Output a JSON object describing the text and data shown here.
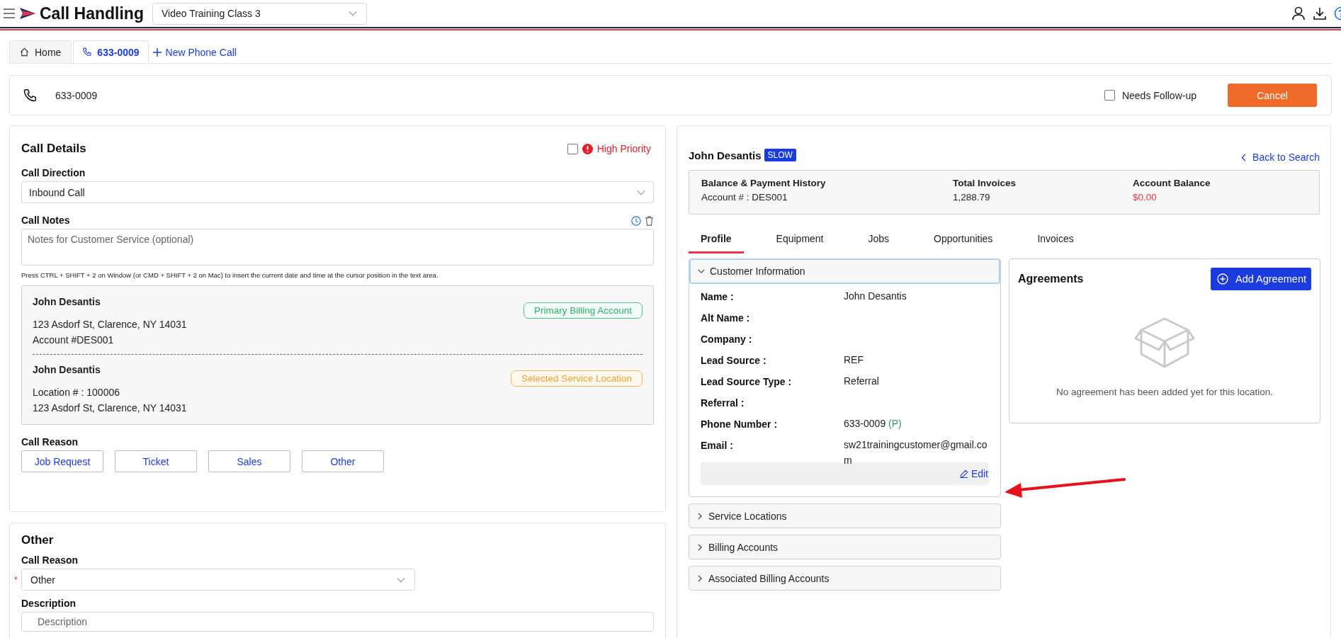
{
  "app": {
    "title": "Call Handling",
    "class_select": "Video Training Class 3"
  },
  "tabs": [
    {
      "kind": "home",
      "label": "Home",
      "selected": false
    },
    {
      "kind": "phone",
      "label": "633-0009",
      "selected": true
    }
  ],
  "new_tab_link": "New Phone Call",
  "call_bar": {
    "phone": "633-0009",
    "follow_up": {
      "label": "Needs Follow-up",
      "checked": false
    },
    "cancel": "Cancel"
  },
  "call_details": {
    "title": "Call Details",
    "high_priority": {
      "label": "High Priority",
      "checked": false
    },
    "direction": {
      "label": "Call Direction",
      "value": "Inbound Call"
    },
    "notes": {
      "label": "Call Notes",
      "placeholder": "Notes for Customer Service (optional)",
      "hint": "Press CTRL + SHIFT + 2 on Window (or CMD + SHIFT + 2 on Mac) to insert the current date and time at the cursor position in the text area."
    },
    "accounts": [
      {
        "kind": "billing",
        "name": "John Desantis",
        "lines": [
          "123 Asdorf St, Clarence, NY 14031",
          "Account #DES001"
        ],
        "tag": "Primary Billing Account"
      },
      {
        "kind": "location",
        "name": "John Desantis",
        "lines": [
          "Location # : 100006",
          "123 Asdorf St, Clarence, NY 14031"
        ],
        "tag": "Selected Service Location"
      }
    ],
    "reason": {
      "label": "Call Reason",
      "buttons": [
        "Job Request",
        "Ticket",
        "Sales",
        "Other"
      ]
    }
  },
  "other": {
    "title": "Other",
    "reason": {
      "label": "Call Reason",
      "value": "Other",
      "required_mark": "*"
    },
    "description": {
      "label": "Description",
      "placeholder": "Description"
    }
  },
  "customer": {
    "name": "John Desantis",
    "badge": "SLOW",
    "back": "Back to Search",
    "summary": [
      {
        "kind": "plain",
        "label": "Balance & Payment History",
        "value": "Account # : DES001"
      },
      {
        "kind": "plain",
        "label": "Total Invoices",
        "value": "1,288.79"
      },
      {
        "kind": "balance",
        "label": "Account Balance",
        "value": "$0.00"
      }
    ],
    "profile_tabs": [
      {
        "label": "Profile",
        "selected": true
      },
      {
        "label": "Equipment",
        "selected": false
      },
      {
        "label": "Jobs",
        "selected": false
      },
      {
        "label": "Opportunities",
        "selected": false
      },
      {
        "label": "Invoices",
        "selected": false
      }
    ],
    "customer_info": {
      "title": "Customer Information",
      "expanded": true,
      "fields": [
        {
          "label": "Name :",
          "value": "John Desantis"
        },
        {
          "label": "Alt Name :"
        },
        {
          "label": "Company :"
        },
        {
          "label": "Lead Source :",
          "value": "REF"
        },
        {
          "label": "Lead Source Type :",
          "value": "Referral"
        },
        {
          "label": "Referral :"
        },
        {
          "label": "Phone Number :",
          "value": "633-0009",
          "tag": "(P)"
        },
        {
          "label": "Email :",
          "value": "sw21trainingcustomer@gmail.com"
        }
      ],
      "edit": "Edit"
    },
    "sections": [
      {
        "title": "Service Locations",
        "expanded": false
      },
      {
        "title": "Billing Accounts",
        "expanded": false
      },
      {
        "title": "Associated Billing Accounts",
        "expanded": false
      }
    ],
    "agreements": {
      "title": "Agreements",
      "button": "Add Agreement",
      "empty": "No agreement has been added yet for this location."
    }
  }
}
